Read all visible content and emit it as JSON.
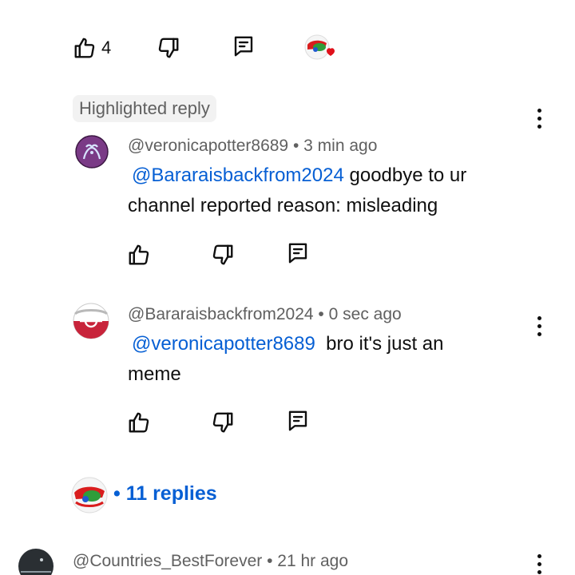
{
  "top_actions": {
    "like_count": "4"
  },
  "highlighted_label": "Highlighted reply",
  "replies": [
    {
      "author": "@veronicapotter8689",
      "time": "3 min ago",
      "mention": "@Bararaisbackfrom2024",
      "text": " goodbye to ur channel reported reason: misleading"
    },
    {
      "author": "@Bararaisbackfrom2024",
      "time": "0 sec ago",
      "mention": "@veronicapotter8689",
      "text": "  bro it's just an meme"
    }
  ],
  "replies_summary": {
    "label": "11 replies"
  },
  "next_comment": {
    "author": "@Countries_BestForever",
    "time": "21 hr ago"
  },
  "separator": " • ",
  "icons": {
    "like": "thumbs-up-icon",
    "dislike": "thumbs-down-icon",
    "reply": "comment-icon",
    "more": "more-vert-icon"
  },
  "colors": {
    "link": "#065fd4",
    "meta": "#606060",
    "chip_bg": "#f2f2f2"
  }
}
